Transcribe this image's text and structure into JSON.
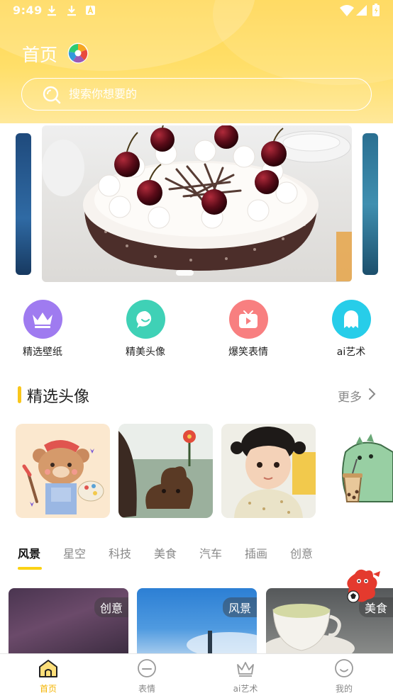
{
  "status_bar": {
    "time": "9:49"
  },
  "header": {
    "title": "首页"
  },
  "search": {
    "placeholder": "搜索你想要的"
  },
  "quick_categories": [
    {
      "label": "精选壁纸",
      "icon": "crown-icon",
      "color": "#9f7bf0"
    },
    {
      "label": "精美头像",
      "icon": "chat-bubble-icon",
      "color": "#3fd1b6"
    },
    {
      "label": "爆笑表情",
      "icon": "tv-play-icon",
      "color": "#f87f80"
    },
    {
      "label": "ai艺术",
      "icon": "ghost-icon",
      "color": "#27cde9"
    }
  ],
  "section": {
    "title": "精选头像",
    "more": "更多"
  },
  "tabs": [
    "风景",
    "星空",
    "科技",
    "美食",
    "汽车",
    "插画",
    "创意"
  ],
  "cards": [
    {
      "tag": "创意"
    },
    {
      "tag": "风景"
    },
    {
      "tag": "美食"
    }
  ],
  "bottom_nav": [
    {
      "label": "首页",
      "icon": "home-icon",
      "active": true
    },
    {
      "label": "表情",
      "icon": "emoji-icon",
      "active": false
    },
    {
      "label": "ai艺术",
      "icon": "crown-icon",
      "active": false
    },
    {
      "label": "我的",
      "icon": "smile-icon",
      "active": false
    }
  ],
  "colors": {
    "accent": "#f4b400",
    "header": "#ffd64f",
    "indicator": "#fbd214"
  }
}
